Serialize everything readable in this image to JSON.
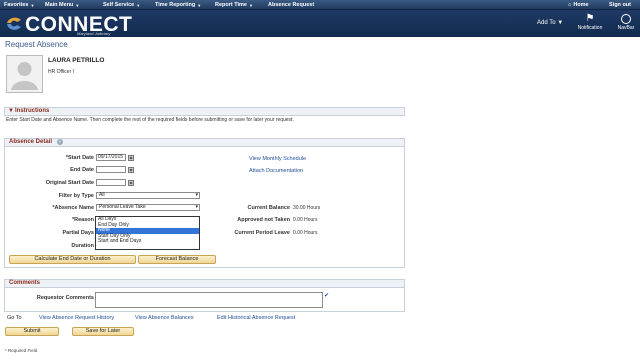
{
  "menu_bar": {
    "items": [
      "Favorites",
      "Main Menu",
      "Self Service",
      "Time Reporting",
      "Report Time",
      "Absence Request"
    ],
    "home": "Home",
    "sign_out": "Sign out"
  },
  "banner": {
    "logo_text": "CONNECT",
    "logo_subtext": "Maryland Judiciary",
    "add_to": "Add To",
    "notification": "Notification",
    "navbar": "NavBar"
  },
  "page_title": "Request Absence",
  "employee": {
    "name": "LAURA PETRILLO",
    "title": "HR Officer I"
  },
  "instructions": {
    "header": "Instructions",
    "text": "Enter Start Date and Absence Name. Then complete the rest of the required fields before submitting or save for later your request."
  },
  "absence_detail": {
    "header": "Absence Detail",
    "start_date_label": "*Start Date",
    "start_date_value": "09/17/2015",
    "end_date_label": "End Date",
    "end_date_value": "",
    "original_start_label": "Original Start Date",
    "original_start_value": "",
    "filter_label": "Filter by Type",
    "filter_value": "All",
    "absence_name_label": "*Absence Name",
    "absence_name_value": "Personal Leave Take",
    "reason_label": "*Reason",
    "partial_days_label": "Partial Days",
    "duration_label": "Duration",
    "partial_days_options": [
      "All Days",
      "End Day Only",
      "None",
      "Start Day Only",
      "Start and End Days"
    ],
    "partial_days_selected": "None",
    "view_monthly": "View Monthly Schedule",
    "attach_doc": "Attach Documentation",
    "current_balance_label": "Current Balance",
    "current_balance_value": "30.00 Hours",
    "approved_not_taken_label": "Approved not Taken",
    "approved_not_taken_value": "0.00 Hours",
    "current_period_leave_label": "Current Period Leave",
    "current_period_leave_value": "0.00 Hours",
    "calc_button": "Calculate End Date or Duration",
    "forecast_button": "Forecast Balance"
  },
  "comments": {
    "header": "Comments",
    "requestor_label": "Requestor Comments",
    "requestor_value": ""
  },
  "goto": {
    "label": "Go To",
    "links": [
      "View Absence Request History",
      "View Absence Balances",
      "Edit Historical Absence Request"
    ]
  },
  "actions": {
    "submit": "Submit",
    "save_later": "Save for Later"
  },
  "footer_note": "* Required Field",
  "colors": {
    "banner": "#1a345e",
    "link": "#1e4e98",
    "section_header_text": "#8a2b1b",
    "button": "#f5e1ab",
    "selection": "#3374d8"
  }
}
